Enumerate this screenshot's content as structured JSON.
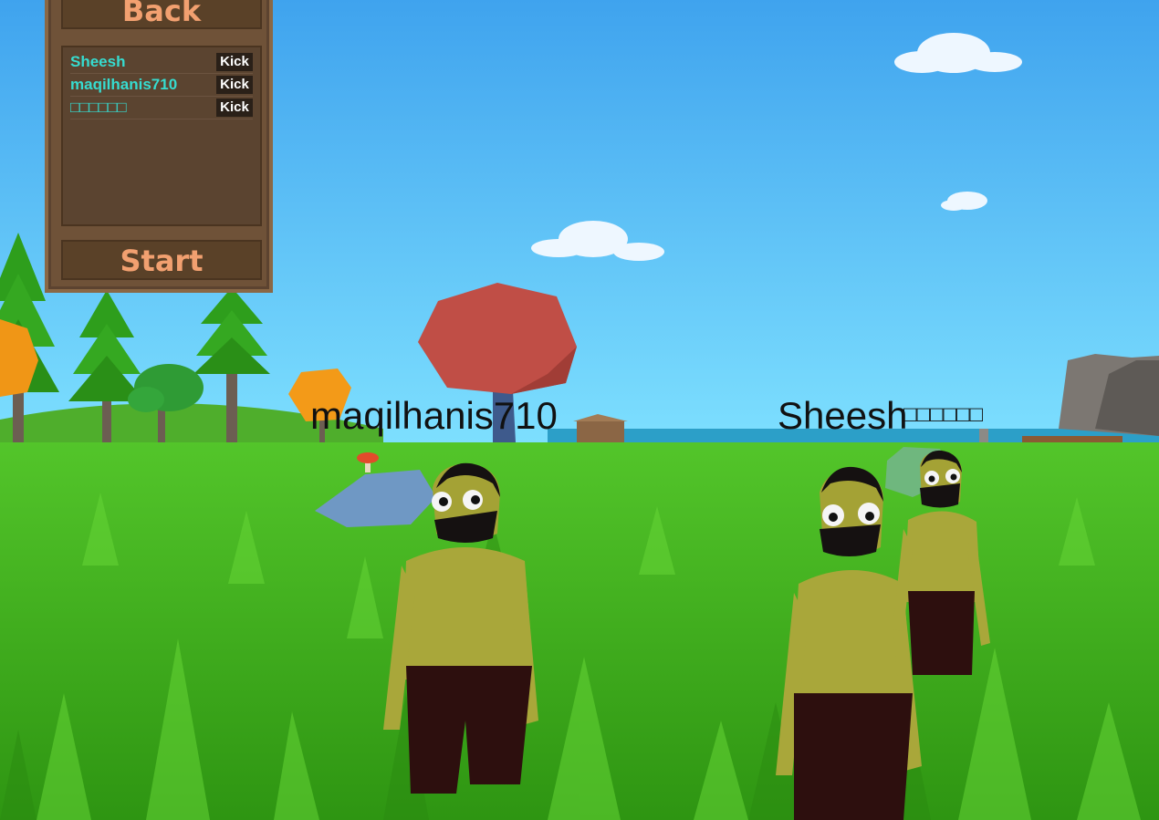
{
  "lobby": {
    "back_label": "Back",
    "start_label": "Start",
    "kick_label": "Kick",
    "players": [
      {
        "name": "Sheesh"
      },
      {
        "name": "maqilhanis710"
      },
      {
        "name": "□□□□□□"
      }
    ]
  },
  "nametags": {
    "player_left": "maqilhanis710",
    "player_center": "Sheesh",
    "player_right": "□□□□□□"
  },
  "colors": {
    "sky": "#5ec3f0",
    "grass": "#3aa81a",
    "panel": "#6f5238",
    "button_text": "#f2a070",
    "player_name": "#36dcd0"
  }
}
